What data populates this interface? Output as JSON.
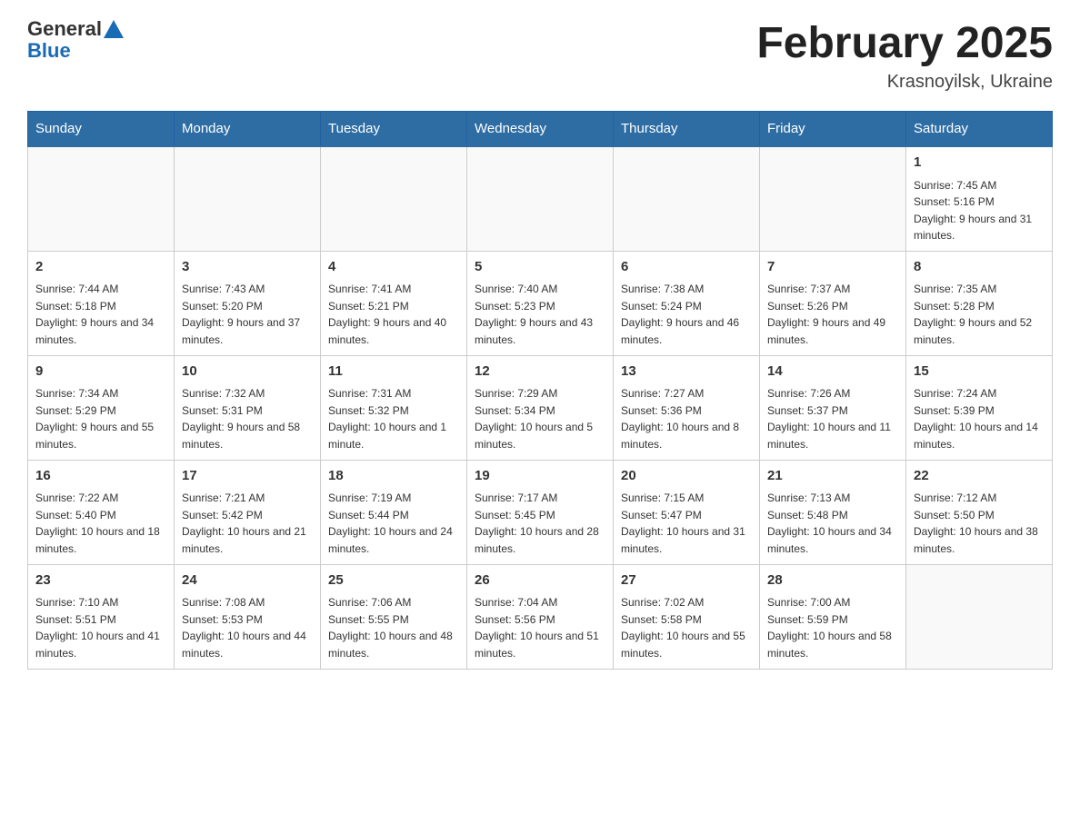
{
  "header": {
    "logo_general": "General",
    "logo_blue": "Blue",
    "month_title": "February 2025",
    "location": "Krasnoyilsk, Ukraine"
  },
  "days_of_week": [
    "Sunday",
    "Monday",
    "Tuesday",
    "Wednesday",
    "Thursday",
    "Friday",
    "Saturday"
  ],
  "weeks": [
    [
      {
        "day": "",
        "sunrise": "",
        "sunset": "",
        "daylight": "",
        "empty": true
      },
      {
        "day": "",
        "sunrise": "",
        "sunset": "",
        "daylight": "",
        "empty": true
      },
      {
        "day": "",
        "sunrise": "",
        "sunset": "",
        "daylight": "",
        "empty": true
      },
      {
        "day": "",
        "sunrise": "",
        "sunset": "",
        "daylight": "",
        "empty": true
      },
      {
        "day": "",
        "sunrise": "",
        "sunset": "",
        "daylight": "",
        "empty": true
      },
      {
        "day": "",
        "sunrise": "",
        "sunset": "",
        "daylight": "",
        "empty": true
      },
      {
        "day": "1",
        "sunrise": "Sunrise: 7:45 AM",
        "sunset": "Sunset: 5:16 PM",
        "daylight": "Daylight: 9 hours and 31 minutes.",
        "empty": false
      }
    ],
    [
      {
        "day": "2",
        "sunrise": "Sunrise: 7:44 AM",
        "sunset": "Sunset: 5:18 PM",
        "daylight": "Daylight: 9 hours and 34 minutes.",
        "empty": false
      },
      {
        "day": "3",
        "sunrise": "Sunrise: 7:43 AM",
        "sunset": "Sunset: 5:20 PM",
        "daylight": "Daylight: 9 hours and 37 minutes.",
        "empty": false
      },
      {
        "day": "4",
        "sunrise": "Sunrise: 7:41 AM",
        "sunset": "Sunset: 5:21 PM",
        "daylight": "Daylight: 9 hours and 40 minutes.",
        "empty": false
      },
      {
        "day": "5",
        "sunrise": "Sunrise: 7:40 AM",
        "sunset": "Sunset: 5:23 PM",
        "daylight": "Daylight: 9 hours and 43 minutes.",
        "empty": false
      },
      {
        "day": "6",
        "sunrise": "Sunrise: 7:38 AM",
        "sunset": "Sunset: 5:24 PM",
        "daylight": "Daylight: 9 hours and 46 minutes.",
        "empty": false
      },
      {
        "day": "7",
        "sunrise": "Sunrise: 7:37 AM",
        "sunset": "Sunset: 5:26 PM",
        "daylight": "Daylight: 9 hours and 49 minutes.",
        "empty": false
      },
      {
        "day": "8",
        "sunrise": "Sunrise: 7:35 AM",
        "sunset": "Sunset: 5:28 PM",
        "daylight": "Daylight: 9 hours and 52 minutes.",
        "empty": false
      }
    ],
    [
      {
        "day": "9",
        "sunrise": "Sunrise: 7:34 AM",
        "sunset": "Sunset: 5:29 PM",
        "daylight": "Daylight: 9 hours and 55 minutes.",
        "empty": false
      },
      {
        "day": "10",
        "sunrise": "Sunrise: 7:32 AM",
        "sunset": "Sunset: 5:31 PM",
        "daylight": "Daylight: 9 hours and 58 minutes.",
        "empty": false
      },
      {
        "day": "11",
        "sunrise": "Sunrise: 7:31 AM",
        "sunset": "Sunset: 5:32 PM",
        "daylight": "Daylight: 10 hours and 1 minute.",
        "empty": false
      },
      {
        "day": "12",
        "sunrise": "Sunrise: 7:29 AM",
        "sunset": "Sunset: 5:34 PM",
        "daylight": "Daylight: 10 hours and 5 minutes.",
        "empty": false
      },
      {
        "day": "13",
        "sunrise": "Sunrise: 7:27 AM",
        "sunset": "Sunset: 5:36 PM",
        "daylight": "Daylight: 10 hours and 8 minutes.",
        "empty": false
      },
      {
        "day": "14",
        "sunrise": "Sunrise: 7:26 AM",
        "sunset": "Sunset: 5:37 PM",
        "daylight": "Daylight: 10 hours and 11 minutes.",
        "empty": false
      },
      {
        "day": "15",
        "sunrise": "Sunrise: 7:24 AM",
        "sunset": "Sunset: 5:39 PM",
        "daylight": "Daylight: 10 hours and 14 minutes.",
        "empty": false
      }
    ],
    [
      {
        "day": "16",
        "sunrise": "Sunrise: 7:22 AM",
        "sunset": "Sunset: 5:40 PM",
        "daylight": "Daylight: 10 hours and 18 minutes.",
        "empty": false
      },
      {
        "day": "17",
        "sunrise": "Sunrise: 7:21 AM",
        "sunset": "Sunset: 5:42 PM",
        "daylight": "Daylight: 10 hours and 21 minutes.",
        "empty": false
      },
      {
        "day": "18",
        "sunrise": "Sunrise: 7:19 AM",
        "sunset": "Sunset: 5:44 PM",
        "daylight": "Daylight: 10 hours and 24 minutes.",
        "empty": false
      },
      {
        "day": "19",
        "sunrise": "Sunrise: 7:17 AM",
        "sunset": "Sunset: 5:45 PM",
        "daylight": "Daylight: 10 hours and 28 minutes.",
        "empty": false
      },
      {
        "day": "20",
        "sunrise": "Sunrise: 7:15 AM",
        "sunset": "Sunset: 5:47 PM",
        "daylight": "Daylight: 10 hours and 31 minutes.",
        "empty": false
      },
      {
        "day": "21",
        "sunrise": "Sunrise: 7:13 AM",
        "sunset": "Sunset: 5:48 PM",
        "daylight": "Daylight: 10 hours and 34 minutes.",
        "empty": false
      },
      {
        "day": "22",
        "sunrise": "Sunrise: 7:12 AM",
        "sunset": "Sunset: 5:50 PM",
        "daylight": "Daylight: 10 hours and 38 minutes.",
        "empty": false
      }
    ],
    [
      {
        "day": "23",
        "sunrise": "Sunrise: 7:10 AM",
        "sunset": "Sunset: 5:51 PM",
        "daylight": "Daylight: 10 hours and 41 minutes.",
        "empty": false
      },
      {
        "day": "24",
        "sunrise": "Sunrise: 7:08 AM",
        "sunset": "Sunset: 5:53 PM",
        "daylight": "Daylight: 10 hours and 44 minutes.",
        "empty": false
      },
      {
        "day": "25",
        "sunrise": "Sunrise: 7:06 AM",
        "sunset": "Sunset: 5:55 PM",
        "daylight": "Daylight: 10 hours and 48 minutes.",
        "empty": false
      },
      {
        "day": "26",
        "sunrise": "Sunrise: 7:04 AM",
        "sunset": "Sunset: 5:56 PM",
        "daylight": "Daylight: 10 hours and 51 minutes.",
        "empty": false
      },
      {
        "day": "27",
        "sunrise": "Sunrise: 7:02 AM",
        "sunset": "Sunset: 5:58 PM",
        "daylight": "Daylight: 10 hours and 55 minutes.",
        "empty": false
      },
      {
        "day": "28",
        "sunrise": "Sunrise: 7:00 AM",
        "sunset": "Sunset: 5:59 PM",
        "daylight": "Daylight: 10 hours and 58 minutes.",
        "empty": false
      },
      {
        "day": "",
        "sunrise": "",
        "sunset": "",
        "daylight": "",
        "empty": true
      }
    ]
  ]
}
